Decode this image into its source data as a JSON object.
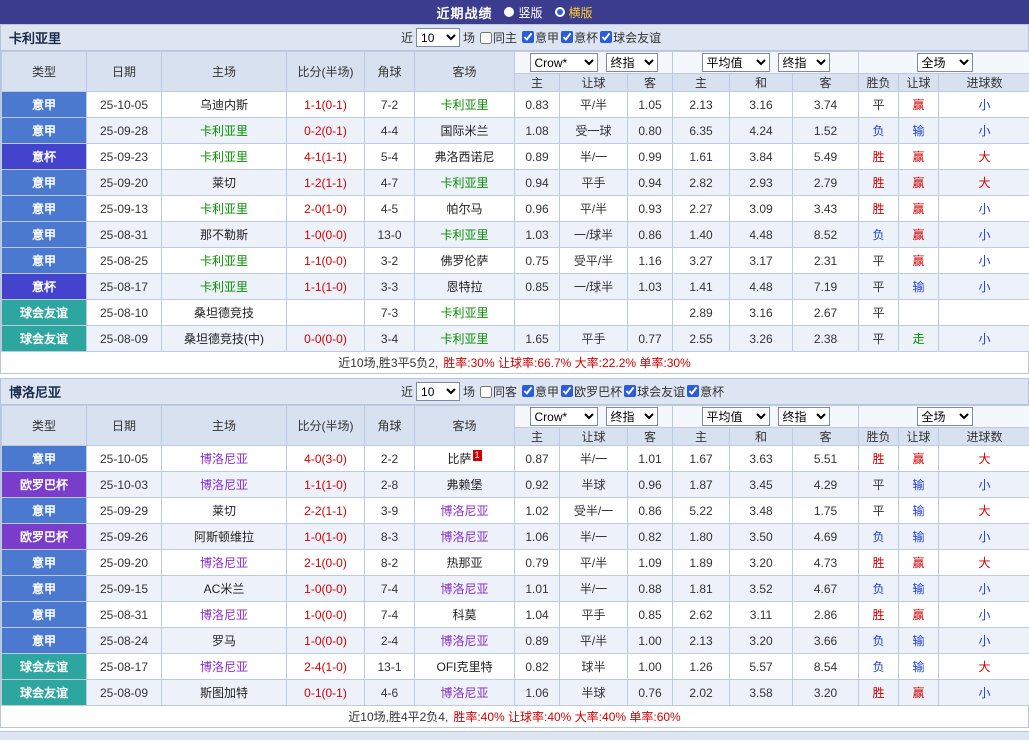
{
  "topbar": {
    "title": "近期战绩",
    "options": [
      {
        "label": "竖版",
        "selected": false
      },
      {
        "label": "横版",
        "selected": true
      }
    ]
  },
  "table_headers": {
    "type": "类型",
    "date": "日期",
    "home": "主场",
    "score": "比分(半场)",
    "corner": "角球",
    "away": "客场",
    "odds_home": "主",
    "odds_handicap": "让球",
    "odds_away": "客",
    "avg_home": "主",
    "avg_draw": "和",
    "avg_away": "客",
    "result": "胜负",
    "handicap_result": "让球",
    "goals": "进球数"
  },
  "type_colors": {
    "意甲": "#4b79cf",
    "意杯": "#4343cd",
    "欧罗巴杯": "#7a3ccb",
    "球会友谊": "#2ea6a0"
  },
  "result_colors": {
    "胜": "#d40000",
    "负": "#1e3fd0",
    "平": "#333333",
    "赢": "#d40000",
    "输": "#1e3fd0",
    "走": "#009900",
    "大": "#d40000",
    "小": "#1e3fd0"
  },
  "sections": [
    {
      "team": "卡利亚里",
      "team_color": "#089000",
      "filter": {
        "near": "近",
        "count": "10",
        "games": "场",
        "same": "同主",
        "leagues": [
          "意甲",
          "意杯",
          "球会友谊"
        ]
      },
      "dropdowns": {
        "source": "Crow*",
        "source_time": "终指",
        "avg": "平均值",
        "avg_time": "终指",
        "scope": "全场"
      },
      "rows": [
        {
          "type": "意甲",
          "date": "25-10-05",
          "home": "乌迪内斯",
          "score": "1-1(0-1)",
          "corner": "7-2",
          "away": "卡利亚里",
          "h": "0.83",
          "handicap": "平/半",
          "a": "1.05",
          "avg_h": "2.13",
          "avg_d": "3.16",
          "avg_a": "3.74",
          "result": "平",
          "hcp_result": "赢",
          "goals": "小"
        },
        {
          "type": "意甲",
          "date": "25-09-28",
          "home": "卡利亚里",
          "score": "0-2(0-1)",
          "corner": "4-4",
          "away": "国际米兰",
          "h": "1.08",
          "handicap": "受一球",
          "a": "0.80",
          "avg_h": "6.35",
          "avg_d": "4.24",
          "avg_a": "1.52",
          "result": "负",
          "hcp_result": "输",
          "goals": "小"
        },
        {
          "type": "意杯",
          "date": "25-09-23",
          "home": "卡利亚里",
          "score": "4-1(1-1)",
          "corner": "5-4",
          "away": "弗洛西诺尼",
          "h": "0.89",
          "handicap": "半/一",
          "a": "0.99",
          "avg_h": "1.61",
          "avg_d": "3.84",
          "avg_a": "5.49",
          "result": "胜",
          "hcp_result": "赢",
          "goals": "大"
        },
        {
          "type": "意甲",
          "date": "25-09-20",
          "home": "莱切",
          "score": "1-2(1-1)",
          "corner": "4-7",
          "away": "卡利亚里",
          "h": "0.94",
          "handicap": "平手",
          "a": "0.94",
          "avg_h": "2.82",
          "avg_d": "2.93",
          "avg_a": "2.79",
          "result": "胜",
          "hcp_result": "赢",
          "goals": "大"
        },
        {
          "type": "意甲",
          "date": "25-09-13",
          "home": "卡利亚里",
          "score": "2-0(1-0)",
          "corner": "4-5",
          "away": "帕尔马",
          "h": "0.96",
          "handicap": "平/半",
          "a": "0.93",
          "avg_h": "2.27",
          "avg_d": "3.09",
          "avg_a": "3.43",
          "result": "胜",
          "hcp_result": "赢",
          "goals": "小"
        },
        {
          "type": "意甲",
          "date": "25-08-31",
          "home": "那不勒斯",
          "score": "1-0(0-0)",
          "corner": "13-0",
          "away": "卡利亚里",
          "h": "1.03",
          "handicap": "一/球半",
          "a": "0.86",
          "avg_h": "1.40",
          "avg_d": "4.48",
          "avg_a": "8.52",
          "result": "负",
          "hcp_result": "赢",
          "goals": "小"
        },
        {
          "type": "意甲",
          "date": "25-08-25",
          "home": "卡利亚里",
          "score": "1-1(0-0)",
          "corner": "3-2",
          "away": "佛罗伦萨",
          "h": "0.75",
          "handicap": "受平/半",
          "a": "1.16",
          "avg_h": "3.27",
          "avg_d": "3.17",
          "avg_a": "2.31",
          "result": "平",
          "hcp_result": "赢",
          "goals": "小"
        },
        {
          "type": "意杯",
          "date": "25-08-17",
          "home": "卡利亚里",
          "score": "1-1(1-0)",
          "corner": "3-3",
          "away": "恩特拉",
          "h": "0.85",
          "handicap": "一/球半",
          "a": "1.03",
          "avg_h": "1.41",
          "avg_d": "4.48",
          "avg_a": "7.19",
          "result": "平",
          "hcp_result": "输",
          "goals": "小"
        },
        {
          "type": "球会友谊",
          "date": "25-08-10",
          "home": "桑坦德竞技",
          "score": "",
          "corner": "7-3",
          "away": "卡利亚里",
          "h": "",
          "handicap": "",
          "a": "",
          "avg_h": "2.89",
          "avg_d": "3.16",
          "avg_a": "2.67",
          "result": "平",
          "hcp_result": "",
          "goals": ""
        },
        {
          "type": "球会友谊",
          "date": "25-08-09",
          "home": "桑坦德竞技(中)",
          "score": "0-0(0-0)",
          "corner": "3-4",
          "away": "卡利亚里",
          "h": "1.65",
          "handicap": "平手",
          "a": "0.77",
          "avg_h": "2.55",
          "avg_d": "3.26",
          "avg_a": "2.38",
          "result": "平",
          "hcp_result": "走",
          "goals": "小"
        }
      ],
      "summary_prefix": "近10场,胜3平5负2,",
      "summary_stats": "胜率:30% 让球率:66.7% 大率:22.2% 单率:30%"
    },
    {
      "team": "博洛尼亚",
      "team_color": "#8a2fc7",
      "filter": {
        "near": "近",
        "count": "10",
        "games": "场",
        "same": "同客",
        "leagues": [
          "意甲",
          "欧罗巴杯",
          "球会友谊",
          "意杯"
        ]
      },
      "dropdowns": {
        "source": "Crow*",
        "source_time": "终指",
        "avg": "平均值",
        "avg_time": "终指",
        "scope": "全场"
      },
      "rows": [
        {
          "type": "意甲",
          "date": "25-10-05",
          "home": "博洛尼亚",
          "score": "4-0(3-0)",
          "corner": "2-2",
          "away": "比萨",
          "away_badge": "1",
          "h": "0.87",
          "handicap": "半/一",
          "a": "1.01",
          "avg_h": "1.67",
          "avg_d": "3.63",
          "avg_a": "5.51",
          "result": "胜",
          "hcp_result": "赢",
          "goals": "大"
        },
        {
          "type": "欧罗巴杯",
          "date": "25-10-03",
          "home": "博洛尼亚",
          "score": "1-1(1-0)",
          "corner": "2-8",
          "away": "弗赖堡",
          "h": "0.92",
          "handicap": "半球",
          "a": "0.96",
          "avg_h": "1.87",
          "avg_d": "3.45",
          "avg_a": "4.29",
          "result": "平",
          "hcp_result": "输",
          "goals": "小"
        },
        {
          "type": "意甲",
          "date": "25-09-29",
          "home": "莱切",
          "score": "2-2(1-1)",
          "corner": "3-9",
          "away": "博洛尼亚",
          "h": "1.02",
          "handicap": "受半/一",
          "a": "0.86",
          "avg_h": "5.22",
          "avg_d": "3.48",
          "avg_a": "1.75",
          "result": "平",
          "hcp_result": "输",
          "goals": "大"
        },
        {
          "type": "欧罗巴杯",
          "date": "25-09-26",
          "home": "阿斯顿维拉",
          "score": "1-0(1-0)",
          "corner": "8-3",
          "away": "博洛尼亚",
          "h": "1.06",
          "handicap": "半/一",
          "a": "0.82",
          "avg_h": "1.80",
          "avg_d": "3.50",
          "avg_a": "4.69",
          "result": "负",
          "hcp_result": "输",
          "goals": "小"
        },
        {
          "type": "意甲",
          "date": "25-09-20",
          "home": "博洛尼亚",
          "score": "2-1(0-0)",
          "corner": "8-2",
          "away": "热那亚",
          "h": "0.79",
          "handicap": "平/半",
          "a": "1.09",
          "avg_h": "1.89",
          "avg_d": "3.20",
          "avg_a": "4.73",
          "result": "胜",
          "hcp_result": "赢",
          "goals": "大"
        },
        {
          "type": "意甲",
          "date": "25-09-15",
          "home": "AC米兰",
          "score": "1-0(0-0)",
          "corner": "7-4",
          "away": "博洛尼亚",
          "h": "1.01",
          "handicap": "半/一",
          "a": "0.88",
          "avg_h": "1.81",
          "avg_d": "3.52",
          "avg_a": "4.67",
          "result": "负",
          "hcp_result": "输",
          "goals": "小"
        },
        {
          "type": "意甲",
          "date": "25-08-31",
          "home": "博洛尼亚",
          "score": "1-0(0-0)",
          "corner": "7-4",
          "away": "科莫",
          "h": "1.04",
          "handicap": "平手",
          "a": "0.85",
          "avg_h": "2.62",
          "avg_d": "3.11",
          "avg_a": "2.86",
          "result": "胜",
          "hcp_result": "赢",
          "goals": "小"
        },
        {
          "type": "意甲",
          "date": "25-08-24",
          "home": "罗马",
          "score": "1-0(0-0)",
          "corner": "2-4",
          "away": "博洛尼亚",
          "h": "0.89",
          "handicap": "平/半",
          "a": "1.00",
          "avg_h": "2.13",
          "avg_d": "3.20",
          "avg_a": "3.66",
          "result": "负",
          "hcp_result": "输",
          "goals": "小"
        },
        {
          "type": "球会友谊",
          "date": "25-08-17",
          "home": "博洛尼亚",
          "score": "2-4(1-0)",
          "corner": "13-1",
          "away": "OFI克里特",
          "h": "0.82",
          "handicap": "球半",
          "a": "1.00",
          "avg_h": "1.26",
          "avg_d": "5.57",
          "avg_a": "8.54",
          "result": "负",
          "hcp_result": "输",
          "goals": "大"
        },
        {
          "type": "球会友谊",
          "date": "25-08-09",
          "home": "斯图加特",
          "score": "0-1(0-1)",
          "corner": "4-6",
          "away": "博洛尼亚",
          "h": "1.06",
          "handicap": "半球",
          "a": "0.76",
          "avg_h": "2.02",
          "avg_d": "3.58",
          "avg_a": "3.20",
          "result": "胜",
          "hcp_result": "赢",
          "goals": "小"
        }
      ],
      "summary_prefix": "近10场,胜4平2负4,",
      "summary_stats": "胜率:40% 让球率:40% 大率:40% 单率:60%"
    }
  ]
}
